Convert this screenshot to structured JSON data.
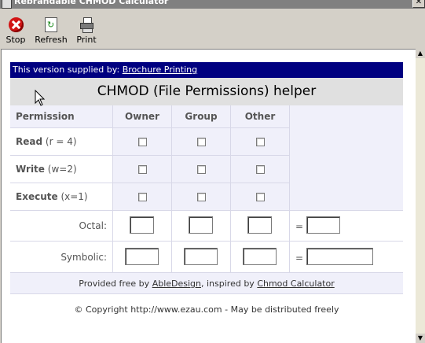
{
  "window": {
    "title": "Rebrandable CHMOD Calculator",
    "close_glyph": "✕"
  },
  "toolbar": {
    "stop_label": "Stop",
    "refresh_label": "Refresh",
    "print_label": "Print"
  },
  "supplier": {
    "prefix": "This version supplied by:",
    "link": "Brochure Printing"
  },
  "helper": {
    "title": "CHMOD (File Permissions) helper"
  },
  "table": {
    "headers": {
      "permission": "Permission",
      "owner": "Owner",
      "group": "Group",
      "other": "Other"
    },
    "rows": [
      {
        "name": "Read",
        "hint": "(r = 4)"
      },
      {
        "name": "Write",
        "hint": "(w=2)"
      },
      {
        "name": "Execute",
        "hint": "(x=1)"
      }
    ],
    "octal_label": "Octal:",
    "symbolic_label": "Symbolic:",
    "equals": "="
  },
  "credits": {
    "prefix": "Provided free by",
    "link1": "AbleDesign",
    "middle": ", inspired by",
    "link2": "Chmod Calculator"
  },
  "copyright": "© Copyright http://www.ezau.com - May be distributed freely"
}
